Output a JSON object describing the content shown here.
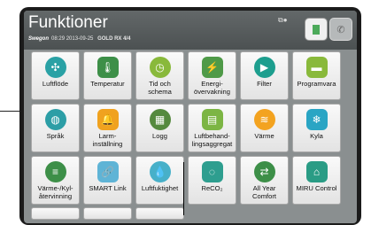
{
  "header": {
    "title": "Funktioner",
    "brand": "Swegon",
    "time": "08:29",
    "date": "2013-09-25",
    "model": "GOLD RX 4/4"
  },
  "tiles": [
    {
      "label": "Luftflöde",
      "icon": "fan-icon",
      "color": "#2aa1a5",
      "glyph": "✣"
    },
    {
      "label": "Temperatur",
      "icon": "thermometer-icon",
      "color": "#3d8f48",
      "glyph": "🌡"
    },
    {
      "label": "Tid och\nschema",
      "icon": "clock-icon",
      "color": "#89b93b",
      "glyph": "◷"
    },
    {
      "label": "Energi-\növervakning",
      "icon": "energy-icon",
      "color": "#4f9a48",
      "glyph": "⚡"
    },
    {
      "label": "Filter",
      "icon": "filter-icon",
      "color": "#1d9e8e",
      "glyph": "▶"
    },
    {
      "label": "Programvara",
      "icon": "software-icon",
      "color": "#89b93b",
      "glyph": "▬"
    },
    {
      "label": "Språk",
      "icon": "globe-icon",
      "color": "#2c9ea6",
      "glyph": "◍"
    },
    {
      "label": "Larm-\ninställning",
      "icon": "bell-icon",
      "color": "#f0a21f",
      "glyph": "🔔"
    },
    {
      "label": "Logg",
      "icon": "chart-icon",
      "color": "#558a3e",
      "glyph": "▦"
    },
    {
      "label": "Luftbehand-\nlingsaggregat",
      "icon": "air-handler-icon",
      "color": "#7cb544",
      "glyph": "▤"
    },
    {
      "label": "Värme",
      "icon": "heat-icon",
      "color": "#f3a320",
      "glyph": "≋"
    },
    {
      "label": "Kyla",
      "icon": "snowflake-icon",
      "color": "#2aa5c4",
      "glyph": "❄"
    },
    {
      "label": "Värme-/Kyl-\nåtervinning",
      "icon": "recovery-icon",
      "color": "#3d8f48",
      "glyph": "≡"
    },
    {
      "label": "SMART Link",
      "icon": "link-icon",
      "color": "#5fb4d6",
      "glyph": "🔗"
    },
    {
      "label": "Luftfuktighet",
      "icon": "droplets-icon",
      "color": "#47b0c9",
      "glyph": "💧"
    },
    {
      "label": "ReCO₂",
      "icon": "reco2-icon",
      "color": "#2e9e8f",
      "glyph": "◌"
    },
    {
      "label": "All Year\nComfort",
      "icon": "arrows-icon",
      "color": "#3d8f48",
      "glyph": "⇄"
    },
    {
      "label": "MIRU Control",
      "icon": "house-icon",
      "color": "#2a9c85",
      "glyph": "⌂"
    }
  ]
}
